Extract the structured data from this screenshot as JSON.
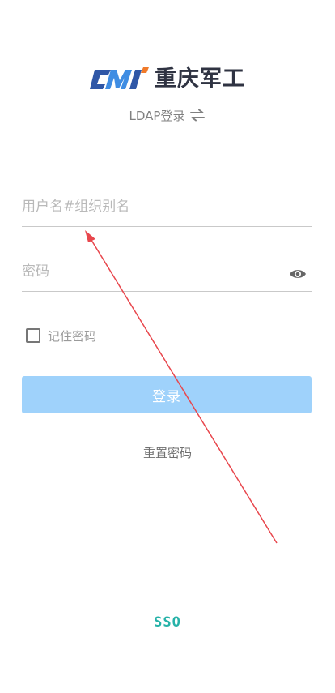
{
  "brand": {
    "name": "重庆军工",
    "colors": {
      "dark_blue": "#2f57a7",
      "light_blue": "#3f8de3",
      "orange": "#f07a2a",
      "text": "#2f3342"
    }
  },
  "login_mode": {
    "label": "LDAP登录",
    "icon": "swap-arrows-icon"
  },
  "form": {
    "username_placeholder": "用户名#组织别名",
    "password_placeholder": "密码",
    "password_icon": "eye-icon",
    "remember_label": "记住密码",
    "remember_checked": false,
    "submit_label": "登录",
    "submit_color": "#9fd2fb"
  },
  "links": {
    "reset_password": "重置密码",
    "sso": "SSO",
    "sso_color": "#26b2a8"
  },
  "annotation": {
    "icon": "red-arrow-annotation-icon",
    "color": "#e8474d"
  }
}
